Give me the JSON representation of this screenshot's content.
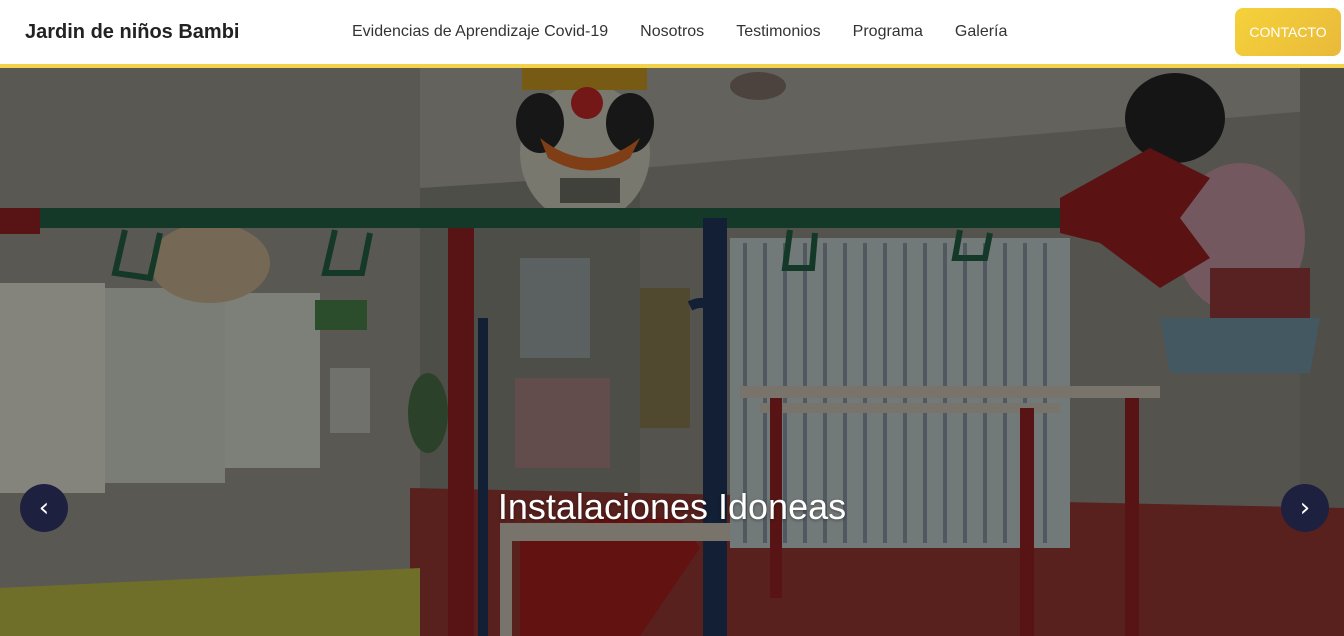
{
  "header": {
    "brand": "Jardin de niños Bambi",
    "nav": [
      {
        "label": "Evidencias de Aprendizaje Covid-19"
      },
      {
        "label": "Nosotros"
      },
      {
        "label": "Testimonios"
      },
      {
        "label": "Programa"
      },
      {
        "label": "Galería"
      }
    ],
    "contact_label": "CONTACTO"
  },
  "hero": {
    "caption": "Instalaciones Idoneas",
    "prev_icon": "‹",
    "next_icon": "›"
  },
  "colors": {
    "accent": "#f2d24a",
    "carousel_button": "#1e2040"
  }
}
